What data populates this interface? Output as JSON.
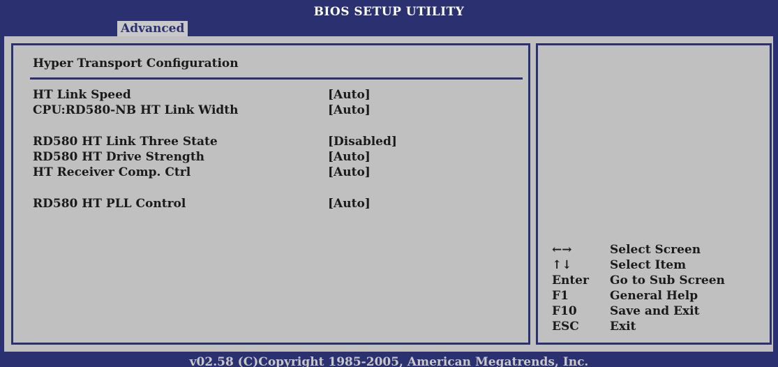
{
  "header": {
    "title": "BIOS SETUP UTILITY",
    "active_tab": "Advanced"
  },
  "section": {
    "title": "Hyper Transport Configuration"
  },
  "settings": [
    {
      "label": "HT Link Speed",
      "value": "[Auto]"
    },
    {
      "label": "CPU:RD580-NB HT Link Width",
      "value": "[Auto]"
    },
    {
      "label": "RD580 HT Link Three State",
      "value": "[Disabled]"
    },
    {
      "label": "RD580 HT Drive Strength",
      "value": "[Auto]"
    },
    {
      "label": "HT Receiver Comp. Ctrl",
      "value": "[Auto]"
    },
    {
      "label": "RD580 HT PLL Control",
      "value": "[Auto]"
    }
  ],
  "help": [
    {
      "key": "←→",
      "desc": "Select Screen",
      "icon": "left-right-arrows-icon"
    },
    {
      "key": "↑↓",
      "desc": "Select Item",
      "icon": "up-down-arrows-icon"
    },
    {
      "key": "Enter",
      "desc": "Go to Sub Screen"
    },
    {
      "key": "F1",
      "desc": "General Help"
    },
    {
      "key": "F10",
      "desc": "Save and Exit"
    },
    {
      "key": "ESC",
      "desc": "Exit"
    }
  ],
  "footer": {
    "text": "v02.58 (C)Copyright 1985-2005, American Megatrends, Inc."
  },
  "colors": {
    "background": "#2b3070",
    "panel": "#c0c0c0",
    "tab": "#c8c8c8",
    "text": "#1a1a1a"
  }
}
